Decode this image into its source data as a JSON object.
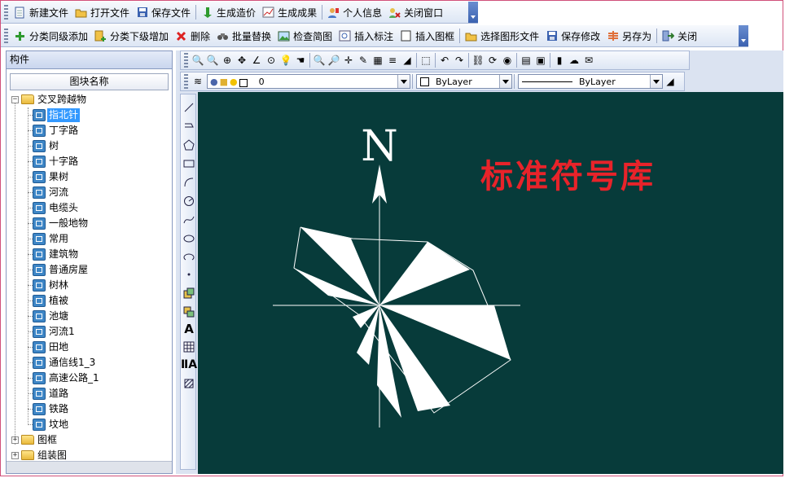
{
  "toolbar_main": {
    "items": [
      {
        "label": "新建文件",
        "icon": "new-file-icon"
      },
      {
        "label": "打开文件",
        "icon": "open-folder-icon"
      },
      {
        "label": "保存文件",
        "icon": "save-disk-icon"
      },
      {
        "label": "生成造价",
        "icon": "green-arrow-icon"
      },
      {
        "label": "生成成果",
        "icon": "chart-icon"
      },
      {
        "label": "个人信息",
        "icon": "user-info-icon"
      },
      {
        "label": "关闭窗口",
        "icon": "close-window-icon"
      }
    ]
  },
  "toolbar_edit": {
    "items": [
      {
        "label": "分类同级添加",
        "icon": "plus-icon"
      },
      {
        "label": "分类下级增加",
        "icon": "add-child-icon"
      },
      {
        "label": "删除",
        "icon": "delete-x-icon"
      },
      {
        "label": "批量替换",
        "icon": "binoculars-icon"
      },
      {
        "label": "检查简图",
        "icon": "picture-icon"
      },
      {
        "label": "插入标注",
        "icon": "annotation-icon"
      },
      {
        "label": "插入图框",
        "icon": "frame-icon"
      },
      {
        "label": "选择图形文件",
        "icon": "folder-icon"
      },
      {
        "label": "保存修改",
        "icon": "save-disk-icon"
      },
      {
        "label": "另存为",
        "icon": "save-as-icon"
      },
      {
        "label": "关闭",
        "icon": "exit-icon"
      }
    ]
  },
  "panel": {
    "title": "构件",
    "column_header": "图块名称"
  },
  "tree": {
    "root_label": "交叉跨越物",
    "selected_label": "指北针",
    "children": [
      "丁字路",
      "树",
      "十字路",
      "果树",
      "河流",
      "电缆头",
      "一般地物",
      "常用",
      "建筑物",
      "普通房屋",
      "树林",
      "植被",
      "池塘",
      "河流1",
      "田地",
      "通信线1_3",
      "高速公路_1",
      "道路",
      "铁路",
      "坟地"
    ],
    "other_roots": [
      "图框",
      "组装图"
    ]
  },
  "layer_bar": {
    "layer_value": "0",
    "color_value": "ByLayer",
    "linetype_value": "ByLayer"
  },
  "canvas": {
    "background": "#073b3a",
    "compass_letter": "N",
    "heading": "标准符号库",
    "heading_color": "#e8232a"
  }
}
